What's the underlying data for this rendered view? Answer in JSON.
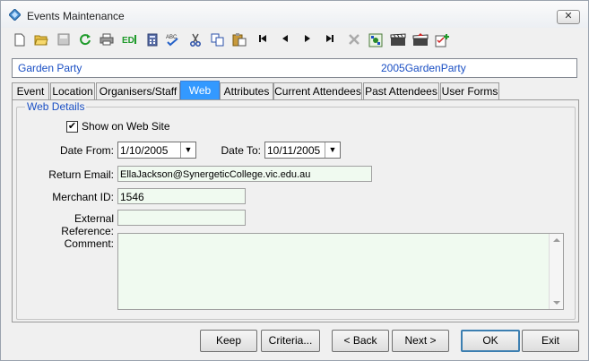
{
  "window": {
    "title": "Events Maintenance"
  },
  "toolbar": {
    "icons": [
      "new-icon",
      "open-icon",
      "save-icon",
      "refresh-icon",
      "print-icon",
      "edit-icon",
      "calculator-icon",
      "spellcheck-icon",
      "cut-icon",
      "copy-icon",
      "paste-icon",
      "first-record-icon",
      "previous-record-icon",
      "next-record-icon",
      "last-record-icon",
      "delete-icon",
      "properties-icon",
      "clapboard-icon",
      "clapboard-red-icon",
      "checklist-add-icon"
    ]
  },
  "banner": {
    "event_name": "Garden Party",
    "event_code": "2005GardenParty"
  },
  "tabs": [
    "Event",
    "Location",
    "Organisers/Staff",
    "Web",
    "Attributes",
    "Current Attendees",
    "Past Attendees",
    "User Forms"
  ],
  "active_tab": "Web",
  "web_details": {
    "legend": "Web Details",
    "show_on_web_label": "Show on Web Site",
    "show_on_web_checked": "✔",
    "date_from_label": "Date From:",
    "date_from_value": "1/10/2005",
    "date_to_label": "Date To:",
    "date_to_value": "10/11/2005",
    "return_email_label": "Return Email:",
    "return_email_value": "EllaJackson@SynergeticCollege.vic.edu.au",
    "merchant_id_label": "Merchant ID:",
    "merchant_id_value": "1546",
    "external_reference_label": "External Reference:",
    "external_reference_value": "",
    "comment_label": "Comment:",
    "comment_value": ""
  },
  "buttons": {
    "keep": "Keep",
    "criteria": "Criteria...",
    "back": "< Back",
    "next": "Next >",
    "ok": "OK",
    "exit": "Exit"
  },
  "colors": {
    "accent": "#3399ff",
    "banner_text": "#1a4fc4",
    "field_bg": "#f0faf0"
  }
}
